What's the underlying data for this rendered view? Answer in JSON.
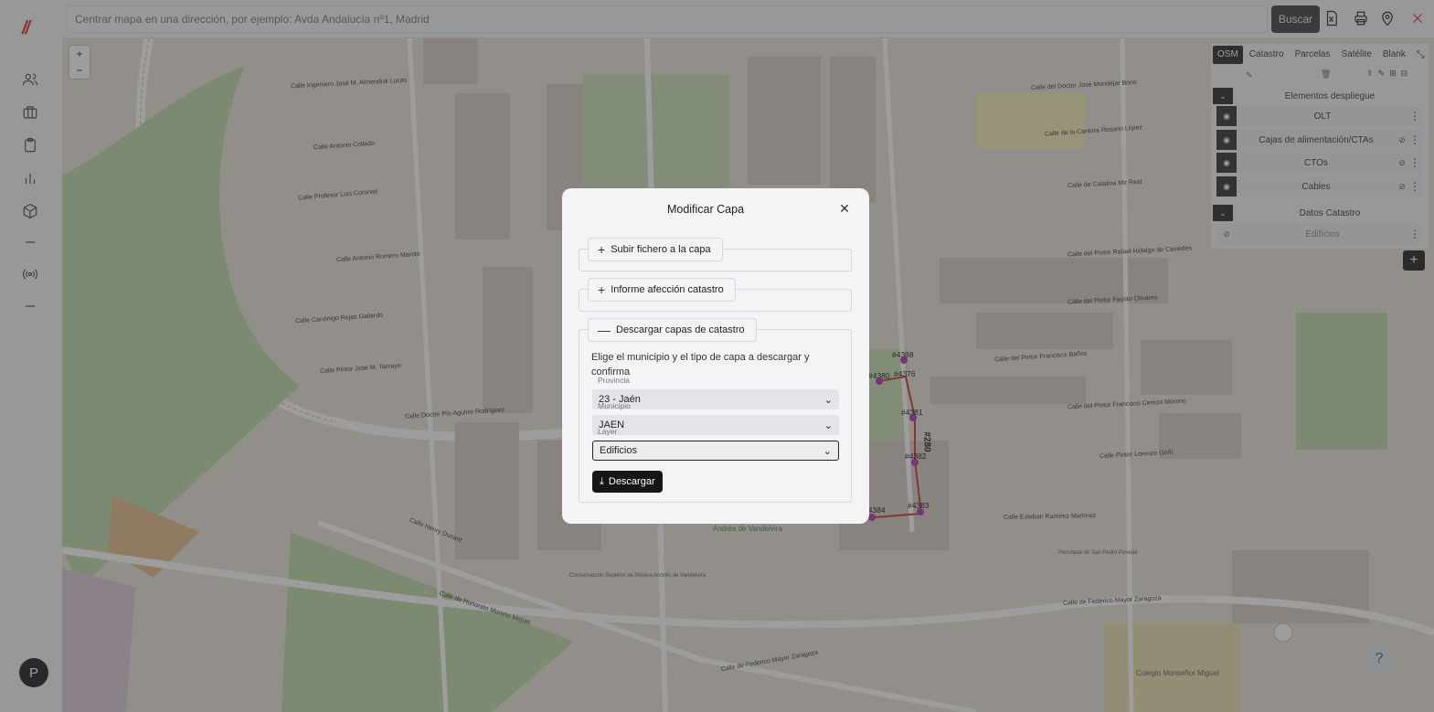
{
  "app": {
    "logo": "//"
  },
  "sidebar": {
    "icons": [
      "users-icon",
      "briefcase-icon",
      "clipboard-icon",
      "chart-icon",
      "box-icon",
      "dash-icon",
      "radio-icon",
      "dash-icon"
    ],
    "avatar": "P"
  },
  "search": {
    "placeholder": "Centrar mapa en una dirección, por ejemplo: Avda Andalucía nº1, Madrid",
    "button": "Buscar"
  },
  "map": {
    "zoom_in": "+",
    "zoom_out": "−",
    "streets": [
      "Calle Ingeniero José M. Almendral Lucas",
      "Calle Antonio Collado",
      "Calle Profesor Luis Coronas",
      "Calle Antonio Romero Maroto",
      "Calle Canónigo Rejas Gallardo",
      "Calle Pintor José M. Tamayo",
      "Calle Doctor Pío Aguirre Rodríguez",
      "Calle Henry Dunant",
      "Calle de Honorato Moreno Mejías",
      "Calle del Doctor José Mondéjar Bono",
      "Calle de la Cantora Rosario López",
      "Calle de Catalina Mir Real",
      "Calle del Pintor Rafael Hidalgo de Caviedes",
      "Calle del Pintor Fausto Olivares",
      "Calle del Pintor Francisco Baños",
      "Calle del Pintor Francisco Cerezo Moreno",
      "Calle Pintor Lorenzo Goñi",
      "Calle Esteban Ramírez Martínez",
      "Calle de Federico Mayor Zaragoza",
      "Calle de Federico Mayor Zaragoza"
    ],
    "nodes": [
      "#4388",
      "#4380",
      "#4376",
      "#4381",
      "#4382",
      "#4384",
      "#4383"
    ],
    "cable_label": "#280",
    "poi": [
      "Andrés de Vandelvira",
      "Colegio Monseñor Miguel",
      "Parroquia de San Pedro Poveda",
      "Conservatorio Superior de Música Andrés de Vandelvira"
    ]
  },
  "layer_panel": {
    "base_tabs": [
      "OSM",
      "Catastro",
      "Parcelas",
      "Satélite",
      "Blank"
    ],
    "active_base": "OSM",
    "groups": [
      {
        "title": "Elementos despliegue",
        "layers": [
          "OLT",
          "Cajas de alimentación/CTAs",
          "CTOs",
          "Cables"
        ]
      },
      {
        "title": "Datos Catastro",
        "layers": [
          "Edificios"
        ]
      }
    ]
  },
  "help": "?",
  "modal": {
    "title": "Modificar Capa",
    "close": "✕",
    "sections": [
      {
        "label": "Subir fichero a la capa",
        "expanded": false
      },
      {
        "label": "Informe afección catastro",
        "expanded": false
      },
      {
        "label": "Descargar capas de catastro",
        "expanded": true
      }
    ],
    "description": "Elige el municipio y el tipo de capa a descargar y confirma",
    "provincia_label": "Provincia",
    "provincia_value": "23 - Jaén",
    "municipio_label": "Municipio",
    "municipio_value": "JAEN",
    "layer_label": "Layer",
    "layer_value": "Edificios",
    "download_button": "Descargar"
  }
}
